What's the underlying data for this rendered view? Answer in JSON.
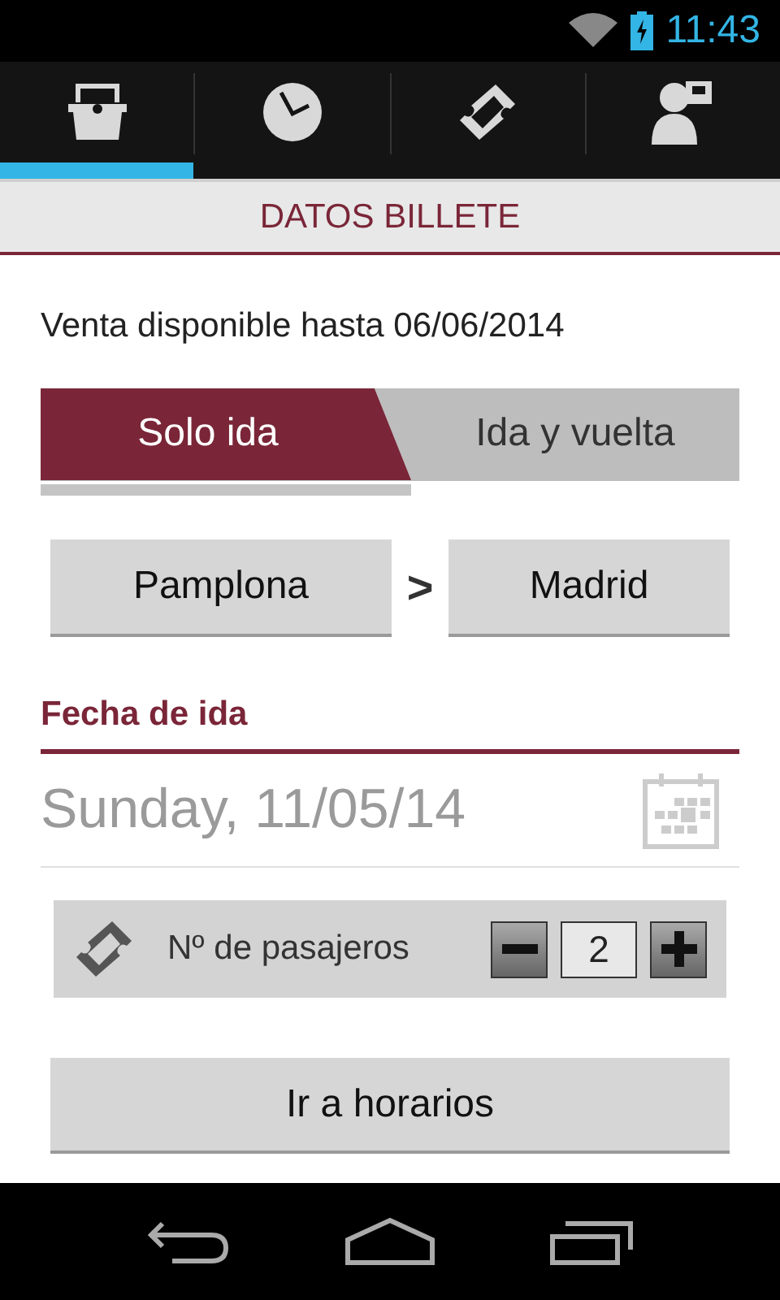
{
  "status_bar": {
    "time": "11:43"
  },
  "tabs": [
    {
      "selected": true
    },
    {
      "selected": false
    },
    {
      "selected": false
    },
    {
      "selected": false
    }
  ],
  "header": {
    "title": "DATOS BILLETE"
  },
  "sale_notice": "Venta disponible hasta 06/06/2014",
  "trip_type": [
    {
      "label": "Solo ida",
      "selected": true
    },
    {
      "label": "Ida y vuelta",
      "selected": false
    }
  ],
  "route": {
    "origin": "Pamplona",
    "separator": ">",
    "destination": "Madrid"
  },
  "departure": {
    "label": "Fecha de ida",
    "date": "Sunday, 11/05/14"
  },
  "passengers": {
    "label": "Nº de pasajeros",
    "count": "2"
  },
  "action_button": "Ir a horarios"
}
